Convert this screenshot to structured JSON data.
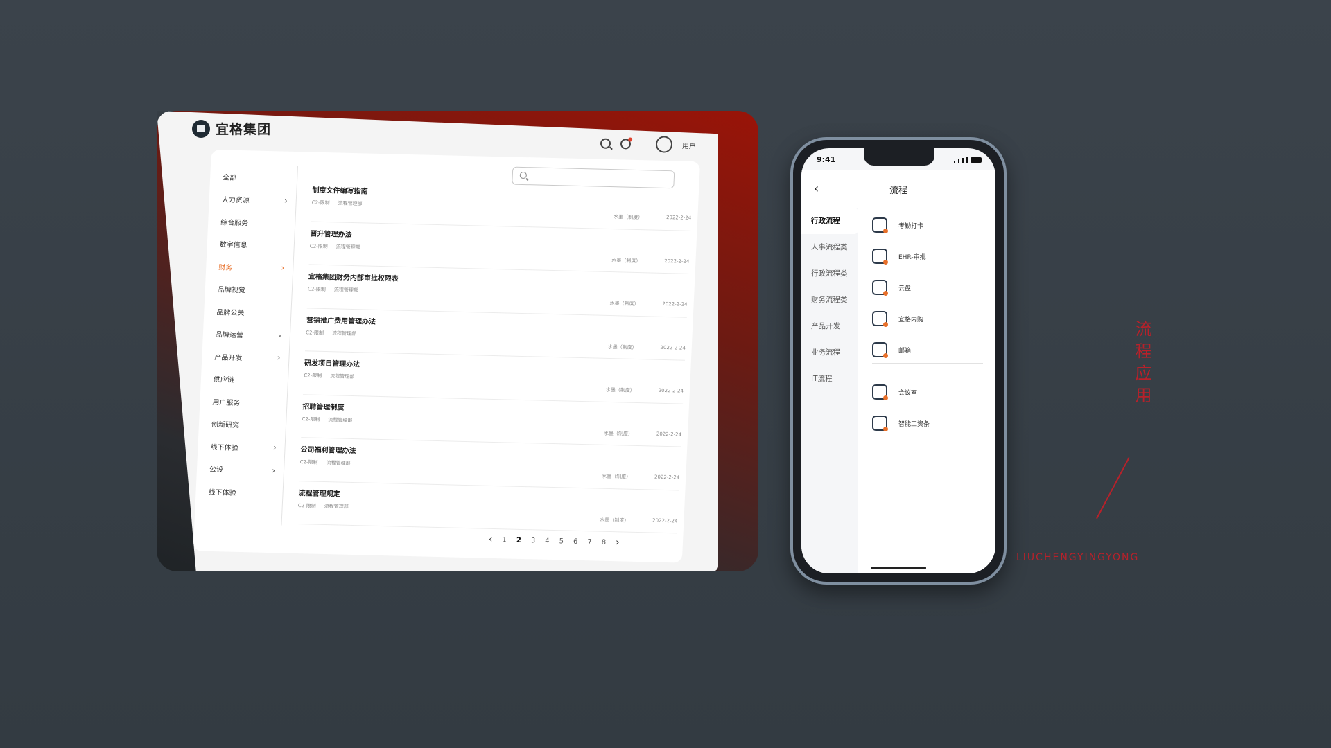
{
  "tablet": {
    "brand": "宜格集团",
    "user": "用户",
    "sidebar": [
      {
        "label": "全部",
        "chevron": false,
        "active": false
      },
      {
        "label": "人力资源",
        "chevron": true,
        "active": false
      },
      {
        "label": "综合服务",
        "chevron": false,
        "active": false
      },
      {
        "label": "数字信息",
        "chevron": false,
        "active": false
      },
      {
        "label": "财务",
        "chevron": true,
        "active": true
      },
      {
        "label": "品牌视觉",
        "chevron": false,
        "active": false
      },
      {
        "label": "品牌公关",
        "chevron": false,
        "active": false
      },
      {
        "label": "品牌运营",
        "chevron": true,
        "active": false
      },
      {
        "label": "产品开发",
        "chevron": true,
        "active": false
      },
      {
        "label": "供应链",
        "chevron": false,
        "active": false
      },
      {
        "label": "用户服务",
        "chevron": false,
        "active": false
      },
      {
        "label": "创新研究",
        "chevron": false,
        "active": false
      },
      {
        "label": "线下体验",
        "chevron": true,
        "active": false
      },
      {
        "label": "公设",
        "chevron": true,
        "active": false
      },
      {
        "label": "线下体验",
        "chevron": false,
        "active": false
      }
    ],
    "search": {
      "placeholder": ""
    },
    "documents": [
      {
        "title": "制度文件编写指南",
        "code": "C2-限制",
        "dept": "流程管理部",
        "author": "水墨（制度）",
        "date": "2022-2-24"
      },
      {
        "title": "晋升管理办法",
        "code": "C2-限制",
        "dept": "流程管理部",
        "author": "水墨（制度）",
        "date": "2022-2-24"
      },
      {
        "title": "宜格集团财务内部审批权限表",
        "code": "C2-限制",
        "dept": "流程管理部",
        "author": "水墨（制度）",
        "date": "2022-2-24"
      },
      {
        "title": "营销推广费用管理办法",
        "code": "C2-限制",
        "dept": "流程管理部",
        "author": "水墨（制度）",
        "date": "2022-2-24"
      },
      {
        "title": "研发项目管理办法",
        "code": "C2-限制",
        "dept": "流程管理部",
        "author": "水墨（制度）",
        "date": "2022-2-24"
      },
      {
        "title": "招聘管理制度",
        "code": "C2-限制",
        "dept": "流程管理部",
        "author": "水墨（制度）",
        "date": "2022-2-24"
      },
      {
        "title": "公司福利管理办法",
        "code": "C2-限制",
        "dept": "流程管理部",
        "author": "水墨（制度）",
        "date": "2022-2-24"
      },
      {
        "title": "流程管理规定",
        "code": "C2-限制",
        "dept": "流程管理部",
        "author": "水墨（制度）",
        "date": "2022-2-24"
      }
    ],
    "pager": {
      "prev": "‹",
      "next": "›",
      "pages": [
        "1",
        "2",
        "3",
        "4",
        "5",
        "6",
        "7",
        "8"
      ],
      "current": "2"
    }
  },
  "phone": {
    "time": "9:41",
    "back": "‹",
    "title": "流程",
    "categories": [
      {
        "label": "行政流程",
        "active": true
      },
      {
        "label": "人事流程类",
        "active": false
      },
      {
        "label": "行政流程类",
        "active": false
      },
      {
        "label": "财务流程类",
        "active": false
      },
      {
        "label": "产品开发",
        "active": false
      },
      {
        "label": "业务流程",
        "active": false
      },
      {
        "label": "IT流程",
        "active": false
      }
    ],
    "apps": [
      {
        "label": "考勤打卡",
        "icon": "calendar-check-icon"
      },
      {
        "label": "EHR-审批",
        "icon": "clipboard-icon"
      },
      {
        "label": "云盘",
        "icon": "cloud-icon"
      },
      {
        "label": "宜格内购",
        "icon": "shopping-bag-icon"
      },
      {
        "label": "邮箱",
        "icon": "mail-icon"
      },
      {
        "label": "会议室",
        "icon": "bar-chart-icon"
      },
      {
        "label": "智能工资条",
        "icon": "money-bag-icon"
      }
    ]
  },
  "caption": {
    "title": "流程应用",
    "pinyin": "LIUCHENGYINGYONG"
  },
  "colors": {
    "accent": "#e8702a",
    "caption": "#b8212a",
    "background": "#3b434b"
  }
}
